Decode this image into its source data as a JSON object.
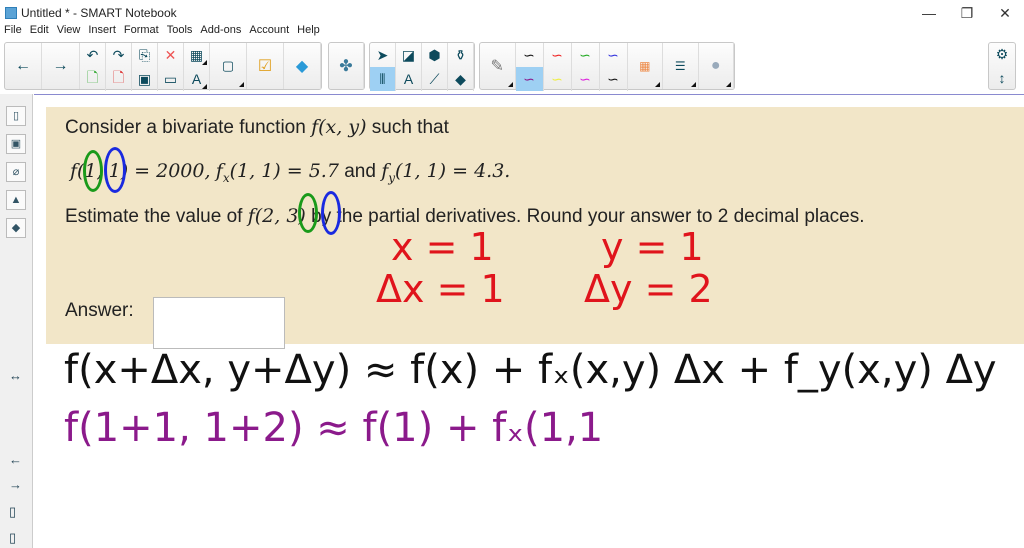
{
  "window": {
    "title": "Untitled * - SMART Notebook",
    "controls": [
      "—",
      "❐",
      "✕"
    ]
  },
  "menu": [
    "File",
    "Edit",
    "View",
    "Insert",
    "Format",
    "Tools",
    "Add-ons",
    "Account",
    "Help"
  ],
  "question": {
    "line1_text": "Consider a bivariate function",
    "line1_math": "f(x, y)",
    "line1_end": "such that",
    "line2_a": "f(1, 1) = 2000,",
    "line2_b": "f",
    "line2_bsub": "x",
    "line2_b2": "(1, 1) = 5.7",
    "line2_and": "and",
    "line2_c": "f",
    "line2_csub": "y",
    "line2_c2": "(1, 1) = 4.3.",
    "line3_a": "Estimate the value of",
    "line3_math": "f(2, 3)",
    "line3_b": "by the partial derivatives. Round your answer to 2 decimal places.",
    "answer_label": "Answer:",
    "answer_value": ""
  },
  "handwriting": {
    "x_eq": "x = 1",
    "dx_eq": "Δx = 1",
    "y_eq": "y = 1",
    "dy_eq": "Δy = 2",
    "formula": "f(x+Δx, y+Δy) ≈ f(x) + fₓ(x,y) Δx + f_y(x,y) Δy",
    "substituted": "f(1+1, 1+2) ≈ f(1) + fₓ(1,1"
  },
  "colors": {
    "question_bg": "#f2e6c8",
    "red_ink": "#e0141c",
    "purple_ink": "#8b1a8b",
    "black_ink": "#111111"
  }
}
